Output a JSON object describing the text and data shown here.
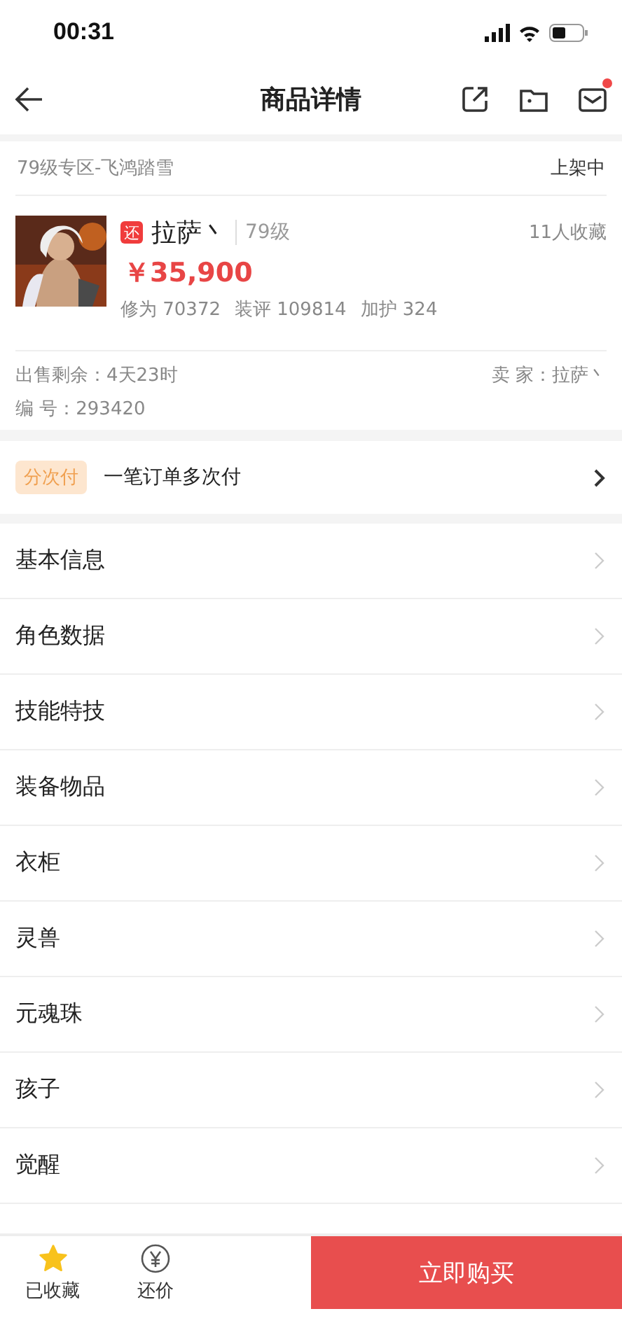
{
  "status_bar": {
    "time": "00:31"
  },
  "nav": {
    "title": "商品详情",
    "mail_unread": true
  },
  "listing": {
    "zone": "79级专区-飞鸿踏雪",
    "status": "上架中",
    "badge": "还",
    "name": "拉萨丶",
    "level": "79级",
    "favorites": "11人收藏",
    "price": "￥35,900",
    "stats": [
      "修为 70372",
      "装评 109814",
      "加护 324"
    ],
    "remaining": "出售剩余：4天23时",
    "seller": "卖 家：拉萨丶",
    "serial": "编 号：293420"
  },
  "installment": {
    "tag": "分次付",
    "text": "一笔订单多次付"
  },
  "sections": [
    {
      "label": "基本信息"
    },
    {
      "label": "角色数据"
    },
    {
      "label": "技能特技"
    },
    {
      "label": "装备物品"
    },
    {
      "label": "衣柜"
    },
    {
      "label": "灵兽"
    },
    {
      "label": "元魂珠"
    },
    {
      "label": "孩子"
    },
    {
      "label": "觉醒"
    }
  ],
  "bottom_bar": {
    "favorite": {
      "label": "已收藏",
      "on": true
    },
    "bargain": {
      "label": "还价"
    },
    "buy": "立即购买"
  }
}
